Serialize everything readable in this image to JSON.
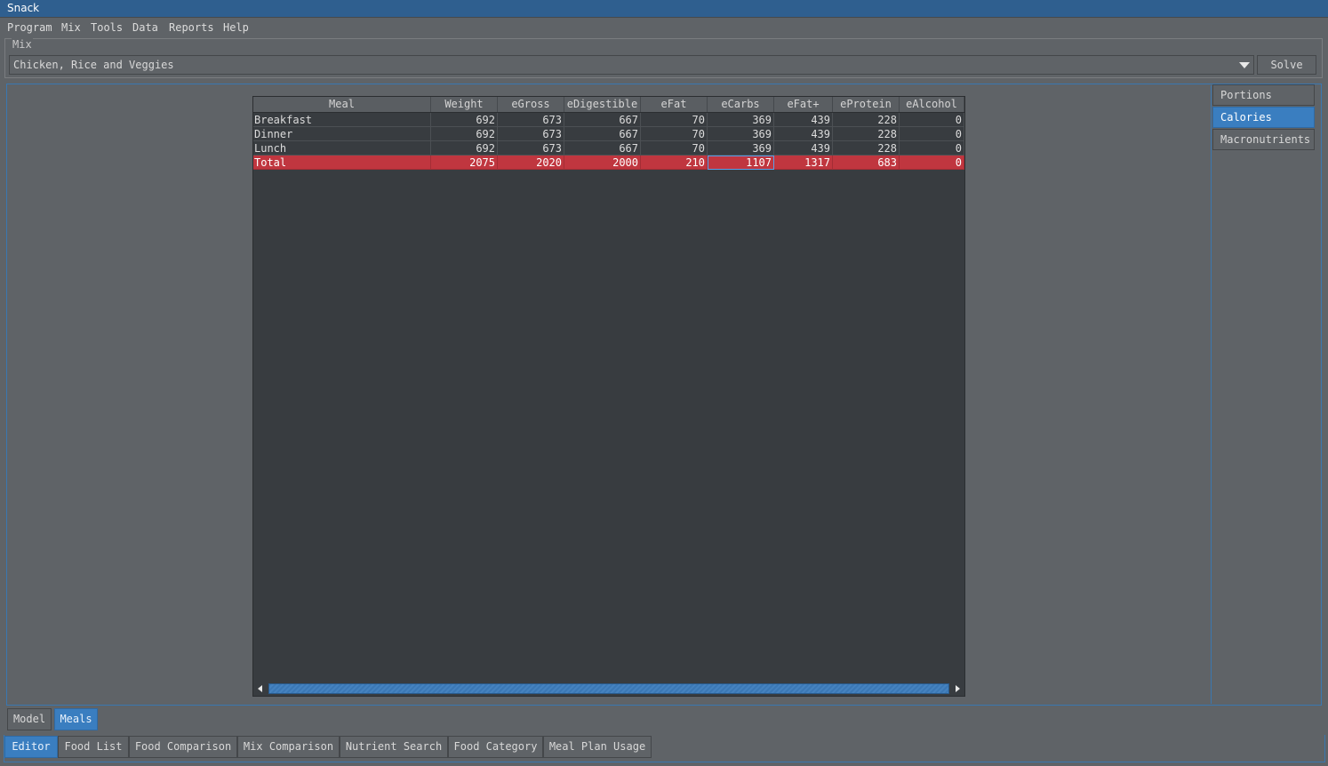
{
  "app": {
    "title": "Snack"
  },
  "menu": [
    "Program",
    "Mix",
    "Tools",
    "Data",
    "Reports",
    "Help"
  ],
  "mix": {
    "group_label": "Mix",
    "selected": "Chicken, Rice and Veggies",
    "solve_label": "Solve"
  },
  "table": {
    "columns": [
      "Meal",
      "Weight",
      "eGross",
      "eDigestible",
      "eFat",
      "eCarbs",
      "eFat+",
      "eProtein",
      "eAlcohol"
    ],
    "rows": [
      [
        "Breakfast",
        "692",
        "673",
        "667",
        "70",
        "369",
        "439",
        "228",
        "0"
      ],
      [
        "Dinner",
        "692",
        "673",
        "667",
        "70",
        "369",
        "439",
        "228",
        "0"
      ],
      [
        "Lunch",
        "692",
        "673",
        "667",
        "70",
        "369",
        "439",
        "228",
        "0"
      ],
      [
        "Total",
        "2075",
        "2020",
        "2000",
        "210",
        "1107",
        "1317",
        "683",
        "0"
      ]
    ]
  },
  "side_tabs": [
    "Portions",
    "Calories",
    "Macronutrients"
  ],
  "side_tab_active": "Calories",
  "view_tabs": [
    "Model",
    "Meals"
  ],
  "view_tab_active": "Meals",
  "main_tabs": [
    "Editor",
    "Food List",
    "Food Comparison",
    "Mix Comparison",
    "Nutrient Search",
    "Food Category",
    "Meal Plan Usage"
  ],
  "main_tab_active": "Editor",
  "colors": {
    "accent": "#3a7ec0",
    "total_row": "#c0363f",
    "titlebar": "#2f5f8f"
  }
}
